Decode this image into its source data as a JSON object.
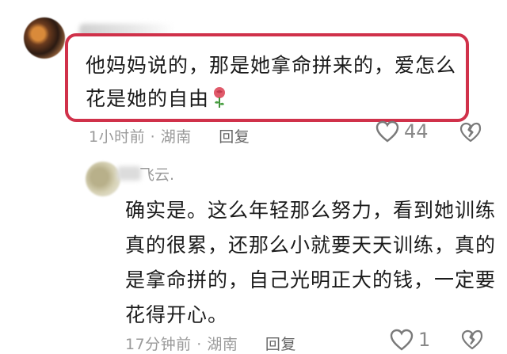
{
  "comment1": {
    "text": "他妈妈说的，那是她拿命拼来的，爱怎么花是她的自由",
    "time": "1小时前",
    "location": "湖南",
    "reply_label": "回复",
    "like_count": "44"
  },
  "comment2": {
    "author_suffix": "飞云.",
    "text": "确实是。这么年轻那么努力，看到她训练真的很累，还那么小就要天天训练，真的是拿命拼的，自己光明正大的钱，一定要花得开心。",
    "time": "17分钟前",
    "location": "湖南",
    "reply_label": "回复",
    "like_count": "1"
  },
  "colors": {
    "highlight": "#d0314a",
    "meta": "#9a9a9a",
    "text": "#1b1b1b"
  },
  "icons": [
    "rose-emoji-icon",
    "heart-outline-icon",
    "broken-heart-icon"
  ]
}
